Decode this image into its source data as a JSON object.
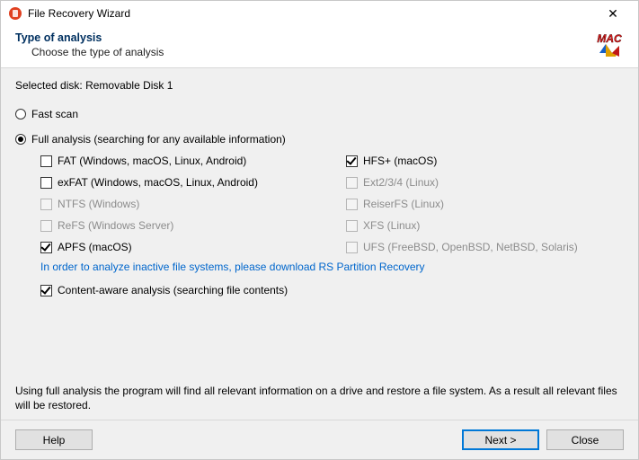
{
  "window": {
    "title": "File Recovery Wizard"
  },
  "header": {
    "title": "Type of analysis",
    "subtitle": "Choose the type of analysis"
  },
  "selected_disk": {
    "label": "Selected disk:",
    "value": "Removable Disk 1"
  },
  "scan": {
    "fast_label": "Fast scan",
    "full_label": "Full analysis (searching for any available information)",
    "selected": "full"
  },
  "filesystems": {
    "left": [
      {
        "label": "FAT (Windows, macOS, Linux, Android)",
        "checked": false,
        "enabled": true
      },
      {
        "label": "exFAT (Windows, macOS, Linux, Android)",
        "checked": false,
        "enabled": true
      },
      {
        "label": "NTFS (Windows)",
        "checked": false,
        "enabled": false
      },
      {
        "label": "ReFS (Windows Server)",
        "checked": false,
        "enabled": false
      },
      {
        "label": "APFS (macOS)",
        "checked": true,
        "enabled": true
      }
    ],
    "right": [
      {
        "label": "HFS+ (macOS)",
        "checked": true,
        "enabled": true
      },
      {
        "label": "Ext2/3/4 (Linux)",
        "checked": false,
        "enabled": false
      },
      {
        "label": "ReiserFS (Linux)",
        "checked": false,
        "enabled": false
      },
      {
        "label": "XFS (Linux)",
        "checked": false,
        "enabled": false
      },
      {
        "label": "UFS (FreeBSD, OpenBSD, NetBSD, Solaris)",
        "checked": false,
        "enabled": false
      }
    ]
  },
  "info_link": "In order to analyze inactive file systems, please download RS Partition Recovery",
  "content_aware": {
    "label": "Content-aware analysis (searching file contents)",
    "checked": true
  },
  "description": "Using full analysis the program will find all relevant information on a drive and restore a file system. As a result all relevant files will be restored.",
  "buttons": {
    "help": "Help",
    "next": "Next >",
    "close": "Close"
  },
  "badge": {
    "text": "MAC"
  }
}
